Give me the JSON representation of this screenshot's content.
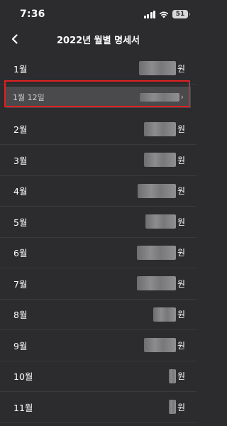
{
  "status_bar": {
    "time": "7:36",
    "battery": "51"
  },
  "nav": {
    "title": "2022년 월별 명세서",
    "back_icon": "chevron-left-icon"
  },
  "months": [
    {
      "label": "1월",
      "unit": "원"
    },
    {
      "label": "2월",
      "unit": "원"
    },
    {
      "label": "3월",
      "unit": "원"
    },
    {
      "label": "4월",
      "unit": "원"
    },
    {
      "label": "5월",
      "unit": "원"
    },
    {
      "label": "6월",
      "unit": "원"
    },
    {
      "label": "7월",
      "unit": "원"
    },
    {
      "label": "8월",
      "unit": "원"
    },
    {
      "label": "9월",
      "unit": "원"
    },
    {
      "label": "10월",
      "unit": "원"
    },
    {
      "label": "11월",
      "unit": "원"
    }
  ],
  "sub_entry": {
    "label": "1월 12일",
    "chevron": "›"
  },
  "colors": {
    "background": "#2c2c2e",
    "highlight": "#e02020",
    "sub_row": "#4a4a4c"
  }
}
